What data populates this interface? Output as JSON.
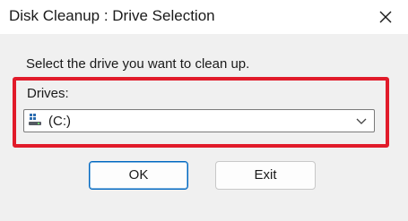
{
  "window": {
    "title": "Disk Cleanup : Drive Selection",
    "close_icon": "close-icon"
  },
  "main": {
    "prompt": "Select the drive you want to clean up.",
    "drives_label": "Drives:",
    "drive_select": {
      "selected_value": "(C:)",
      "icon": "drive-icon"
    }
  },
  "buttons": {
    "ok_label": "OK",
    "exit_label": "Exit"
  },
  "colors": {
    "highlight_border": "#e11b2a",
    "default_button_accent": "#0067c0"
  }
}
